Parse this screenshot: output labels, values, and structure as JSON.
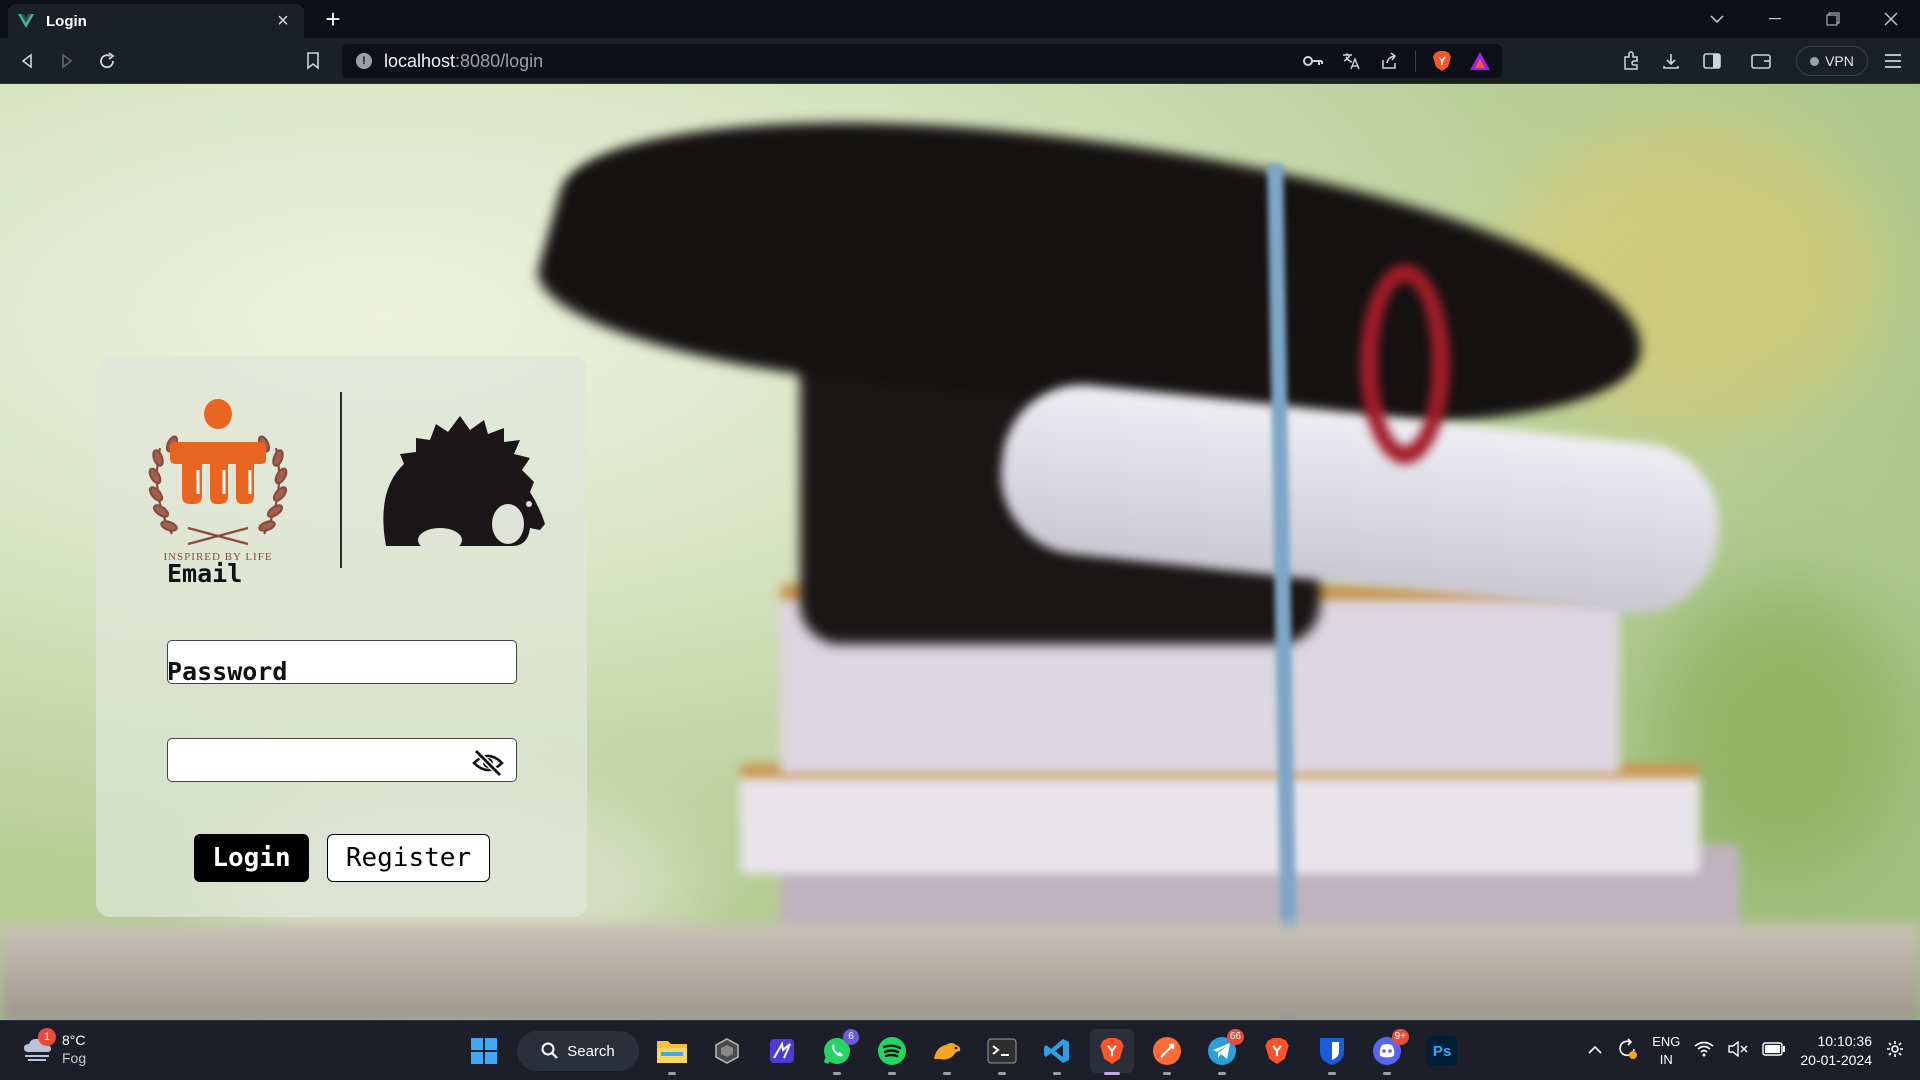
{
  "browser": {
    "tab_title": "Login",
    "url_host": "localhost",
    "url_rest": ":8080/login",
    "vpn_label": "VPN"
  },
  "login": {
    "logo_tagline": "INSPIRED BY LIFE",
    "email_label": "Email",
    "email_value": "",
    "password_label": "Password",
    "password_value": "",
    "login_button": "Login",
    "register_button": "Register"
  },
  "taskbar": {
    "weather_temp": "8°C",
    "weather_desc": "Fog",
    "weather_badge": "1",
    "search_label": "Search",
    "whatsapp_badge": "6",
    "telegram_badge": "66",
    "discord_badge": "9+",
    "photoshop_label": "Ps",
    "lang_top": "ENG",
    "lang_bottom": "IN",
    "time": "10:10:36",
    "date": "20-01-2024"
  },
  "colors": {
    "mit_orange": "#e8641f",
    "login_bg": "#000000",
    "page_bg": "#b9cf98"
  }
}
